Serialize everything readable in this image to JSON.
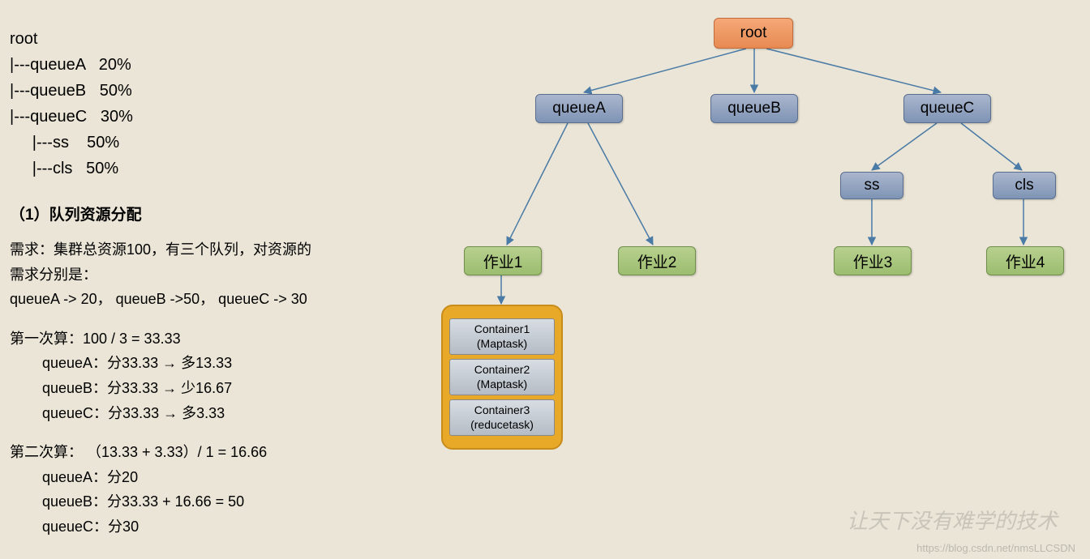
{
  "tree": {
    "l1": "root",
    "l2": "|---queueA   20%",
    "l3": "|---queueB   50%",
    "l4": "|---queueC   30%",
    "l5": "     |---ss    50%",
    "l6": "     |---cls   50%"
  },
  "section_title": "（1）队列资源分配",
  "demand": {
    "l1": "需求：集群总资源100，有三个队列，对资源的",
    "l2": "需求分别是：",
    "l3": "queueA -> 20， queueB ->50， queueC -> 30"
  },
  "calc1": {
    "title": "第一次算：100 / 3 = 33.33",
    "a": "queueA：分33.33 → 多13.33",
    "b": "queueB：分33.33 → 少16.67",
    "c": "queueC：分33.33 → 多3.33"
  },
  "calc2": {
    "title": "第二次算： （13.33 + 3.33）/ 1 = 16.66",
    "a": "queueA：分20",
    "b": "queueB：分33.33 + 16.66 = 50",
    "c": "queueC：分30"
  },
  "nodes": {
    "root": "root",
    "queueA": "queueA",
    "queueB": "queueB",
    "queueC": "queueC",
    "ss": "ss",
    "cls": "cls",
    "job1": "作业1",
    "job2": "作业2",
    "job3": "作业3",
    "job4": "作业4"
  },
  "containers": {
    "c1a": "Container1",
    "c1b": "(Maptask)",
    "c2a": "Container2",
    "c2b": "(Maptask)",
    "c3a": "Container3",
    "c3b": "(reducetask)"
  },
  "watermark1": "让天下没有难学的技术",
  "watermark2": "https://blog.csdn.net/nmsLLCSDN"
}
